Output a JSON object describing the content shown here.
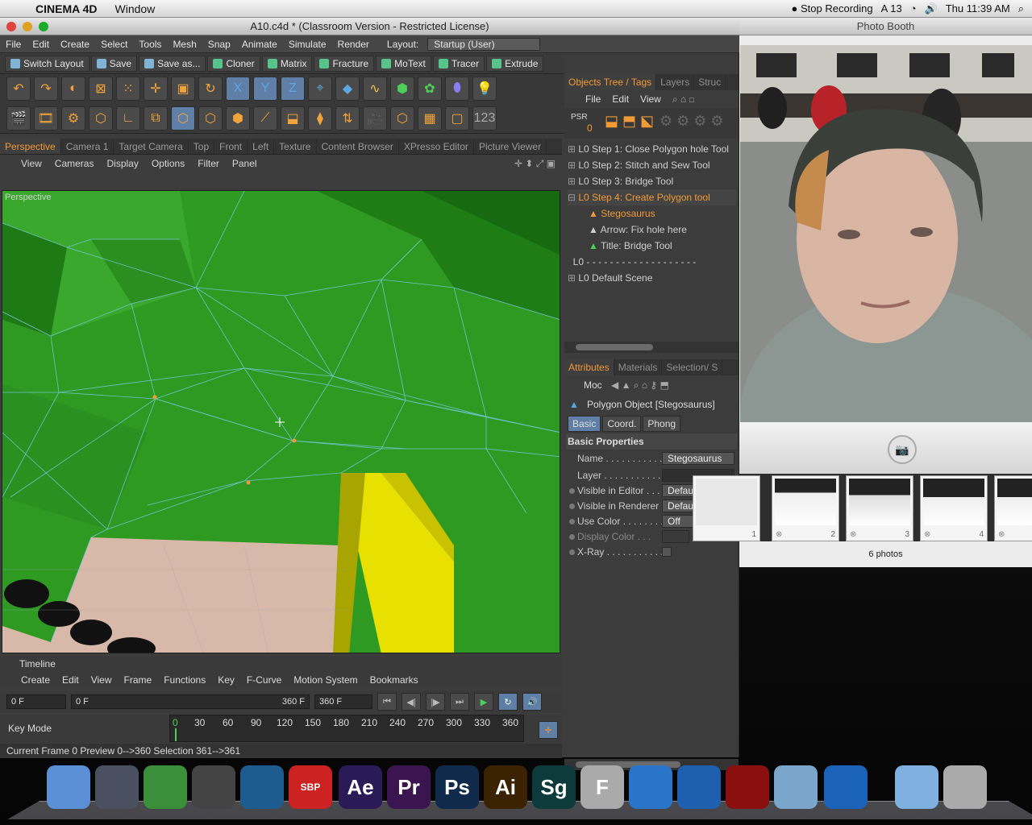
{
  "menubar": {
    "app": "CINEMA 4D",
    "window": "Window",
    "stop_recording": "Stop Recording",
    "adobe_count": "13",
    "clock": "Thu 11:39 AM"
  },
  "c4d": {
    "title": "A10.c4d * (Classroom Version - Restricted License)",
    "menu": [
      "File",
      "Edit",
      "Create",
      "Select",
      "Tools",
      "Mesh",
      "Snap",
      "Animate",
      "Simulate",
      "Render"
    ],
    "layout_label": "Layout:",
    "layout_value": "Startup (User)",
    "toolbar_buttons": [
      "Switch Layout",
      "Save",
      "Save as...",
      "Cloner",
      "Matrix",
      "Fracture",
      "MoText",
      "Tracer",
      "Extrude"
    ],
    "view_tabs": [
      "Perspective",
      "Camera 1",
      "Target Camera",
      "Top",
      "Front",
      "Left",
      "Texture",
      "Content Browser",
      "XPresso Editor",
      "Picture Viewer"
    ],
    "view_menu": [
      "View",
      "Cameras",
      "Display",
      "Options",
      "Filter",
      "Panel"
    ],
    "viewport_label": "Perspective",
    "timeline": {
      "title": "Timeline",
      "menu": [
        "Create",
        "Edit",
        "View",
        "Frame",
        "Functions",
        "Key",
        "F-Curve",
        "Motion System",
        "Bookmarks"
      ],
      "start_field": "0 F",
      "range_start": "0 F",
      "range_end": "360 F",
      "end_field": "360 F",
      "key_mode": "Key Mode",
      "ticks": [
        "0",
        "30",
        "60",
        "90",
        "120",
        "150",
        "180",
        "210",
        "240",
        "270",
        "300",
        "330",
        "360"
      ],
      "status": "Current Frame  0  Preview  0-->360   Selection 361-->361"
    },
    "objects": {
      "tabs": [
        "Objects Tree / Tags",
        "Layers",
        "Struc"
      ],
      "menu": [
        "File",
        "Edit",
        "View"
      ],
      "psr_label": "PSR",
      "psr_value": "0",
      "items": [
        {
          "label": "Step 1: Close Polygon hole Tool",
          "selected": false
        },
        {
          "label": "Step 2: Stitch and Sew Tool",
          "selected": false
        },
        {
          "label": "Step 3: Bridge Tool",
          "selected": false
        },
        {
          "label": "Step 4: Create Polygon tool",
          "selected": true
        },
        {
          "label": "Stegosaurus",
          "selected": true
        },
        {
          "label": "Arrow: Fix hole here",
          "selected": false
        },
        {
          "label": "Title: Bridge  Tool",
          "selected": false
        },
        {
          "label": "0",
          "selected": false
        },
        {
          "label": "Default Scene",
          "selected": false
        }
      ]
    },
    "attributes": {
      "tabs": [
        "Attributes",
        "Materials",
        "Selection/ S"
      ],
      "mode": "Moc",
      "title": "Polygon Object [Stegosaurus]",
      "subtabs": [
        "Basic",
        "Coord.",
        "Phong"
      ],
      "section": "Basic Properties",
      "props": [
        {
          "label": "Name . . . . . . . . . . . .",
          "value": "Stegosaurus"
        },
        {
          "label": "Layer . . . . . . . . . . . .",
          "value": ""
        },
        {
          "label": "Visible in Editor . . .",
          "value": "Default"
        },
        {
          "label": "Visible in Renderer",
          "value": "Default"
        },
        {
          "label": "Use Color . . . . . . . .",
          "value": "Off"
        },
        {
          "label": "Display Color . . .",
          "value": ""
        },
        {
          "label": "X-Ray . . . . . . . . . . .",
          "value": ""
        }
      ]
    }
  },
  "photobooth": {
    "title": "Photo Booth",
    "count": "6 photos",
    "thumb_numbers": [
      "1",
      "2",
      "3",
      "4"
    ]
  },
  "dock": {
    "icons": [
      {
        "name": "finder-icon",
        "label": "",
        "color": "#5b8fd6"
      },
      {
        "name": "warcraft-icon",
        "label": "",
        "color": "#4a5060"
      },
      {
        "name": "evernote-icon",
        "label": "",
        "color": "#3c8f3a"
      },
      {
        "name": "final-cut-icon",
        "label": "",
        "color": "#444"
      },
      {
        "name": "cinema4d-icon",
        "label": "",
        "color": "#1e5b8f"
      },
      {
        "name": "sketchbook-pro-icon",
        "label": "SBP",
        "color": "#c22"
      },
      {
        "name": "after-effects-icon",
        "label": "Ae",
        "color": "#2a1a55"
      },
      {
        "name": "premiere-icon",
        "label": "Pr",
        "color": "#3a1550"
      },
      {
        "name": "photoshop-icon",
        "label": "Ps",
        "color": "#0f2a4a"
      },
      {
        "name": "illustrator-icon",
        "label": "Ai",
        "color": "#3b2200"
      },
      {
        "name": "speedgrade-icon",
        "label": "Sg",
        "color": "#0d3a3a"
      },
      {
        "name": "font-book-icon",
        "label": "F",
        "color": "#aaa"
      },
      {
        "name": "safari-icon",
        "label": "",
        "color": "#2a74c9"
      },
      {
        "name": "itunes-icon",
        "label": "",
        "color": "#1f5fb0"
      },
      {
        "name": "photo-booth-icon",
        "label": "",
        "color": "#8a1010"
      },
      {
        "name": "facetime-icon",
        "label": "",
        "color": "#7aa6cc"
      },
      {
        "name": "quicktime-icon",
        "label": "",
        "color": "#1a63b8"
      },
      {
        "name": "downloads-folder-icon",
        "label": "",
        "color": "#7fb0e0"
      },
      {
        "name": "trash-icon",
        "label": "",
        "color": "#aaa"
      }
    ]
  },
  "colors": {
    "accent_orange": "#f29a35",
    "panel_bg": "#3c3c3c",
    "viewport_green": "#2f8a1f"
  }
}
